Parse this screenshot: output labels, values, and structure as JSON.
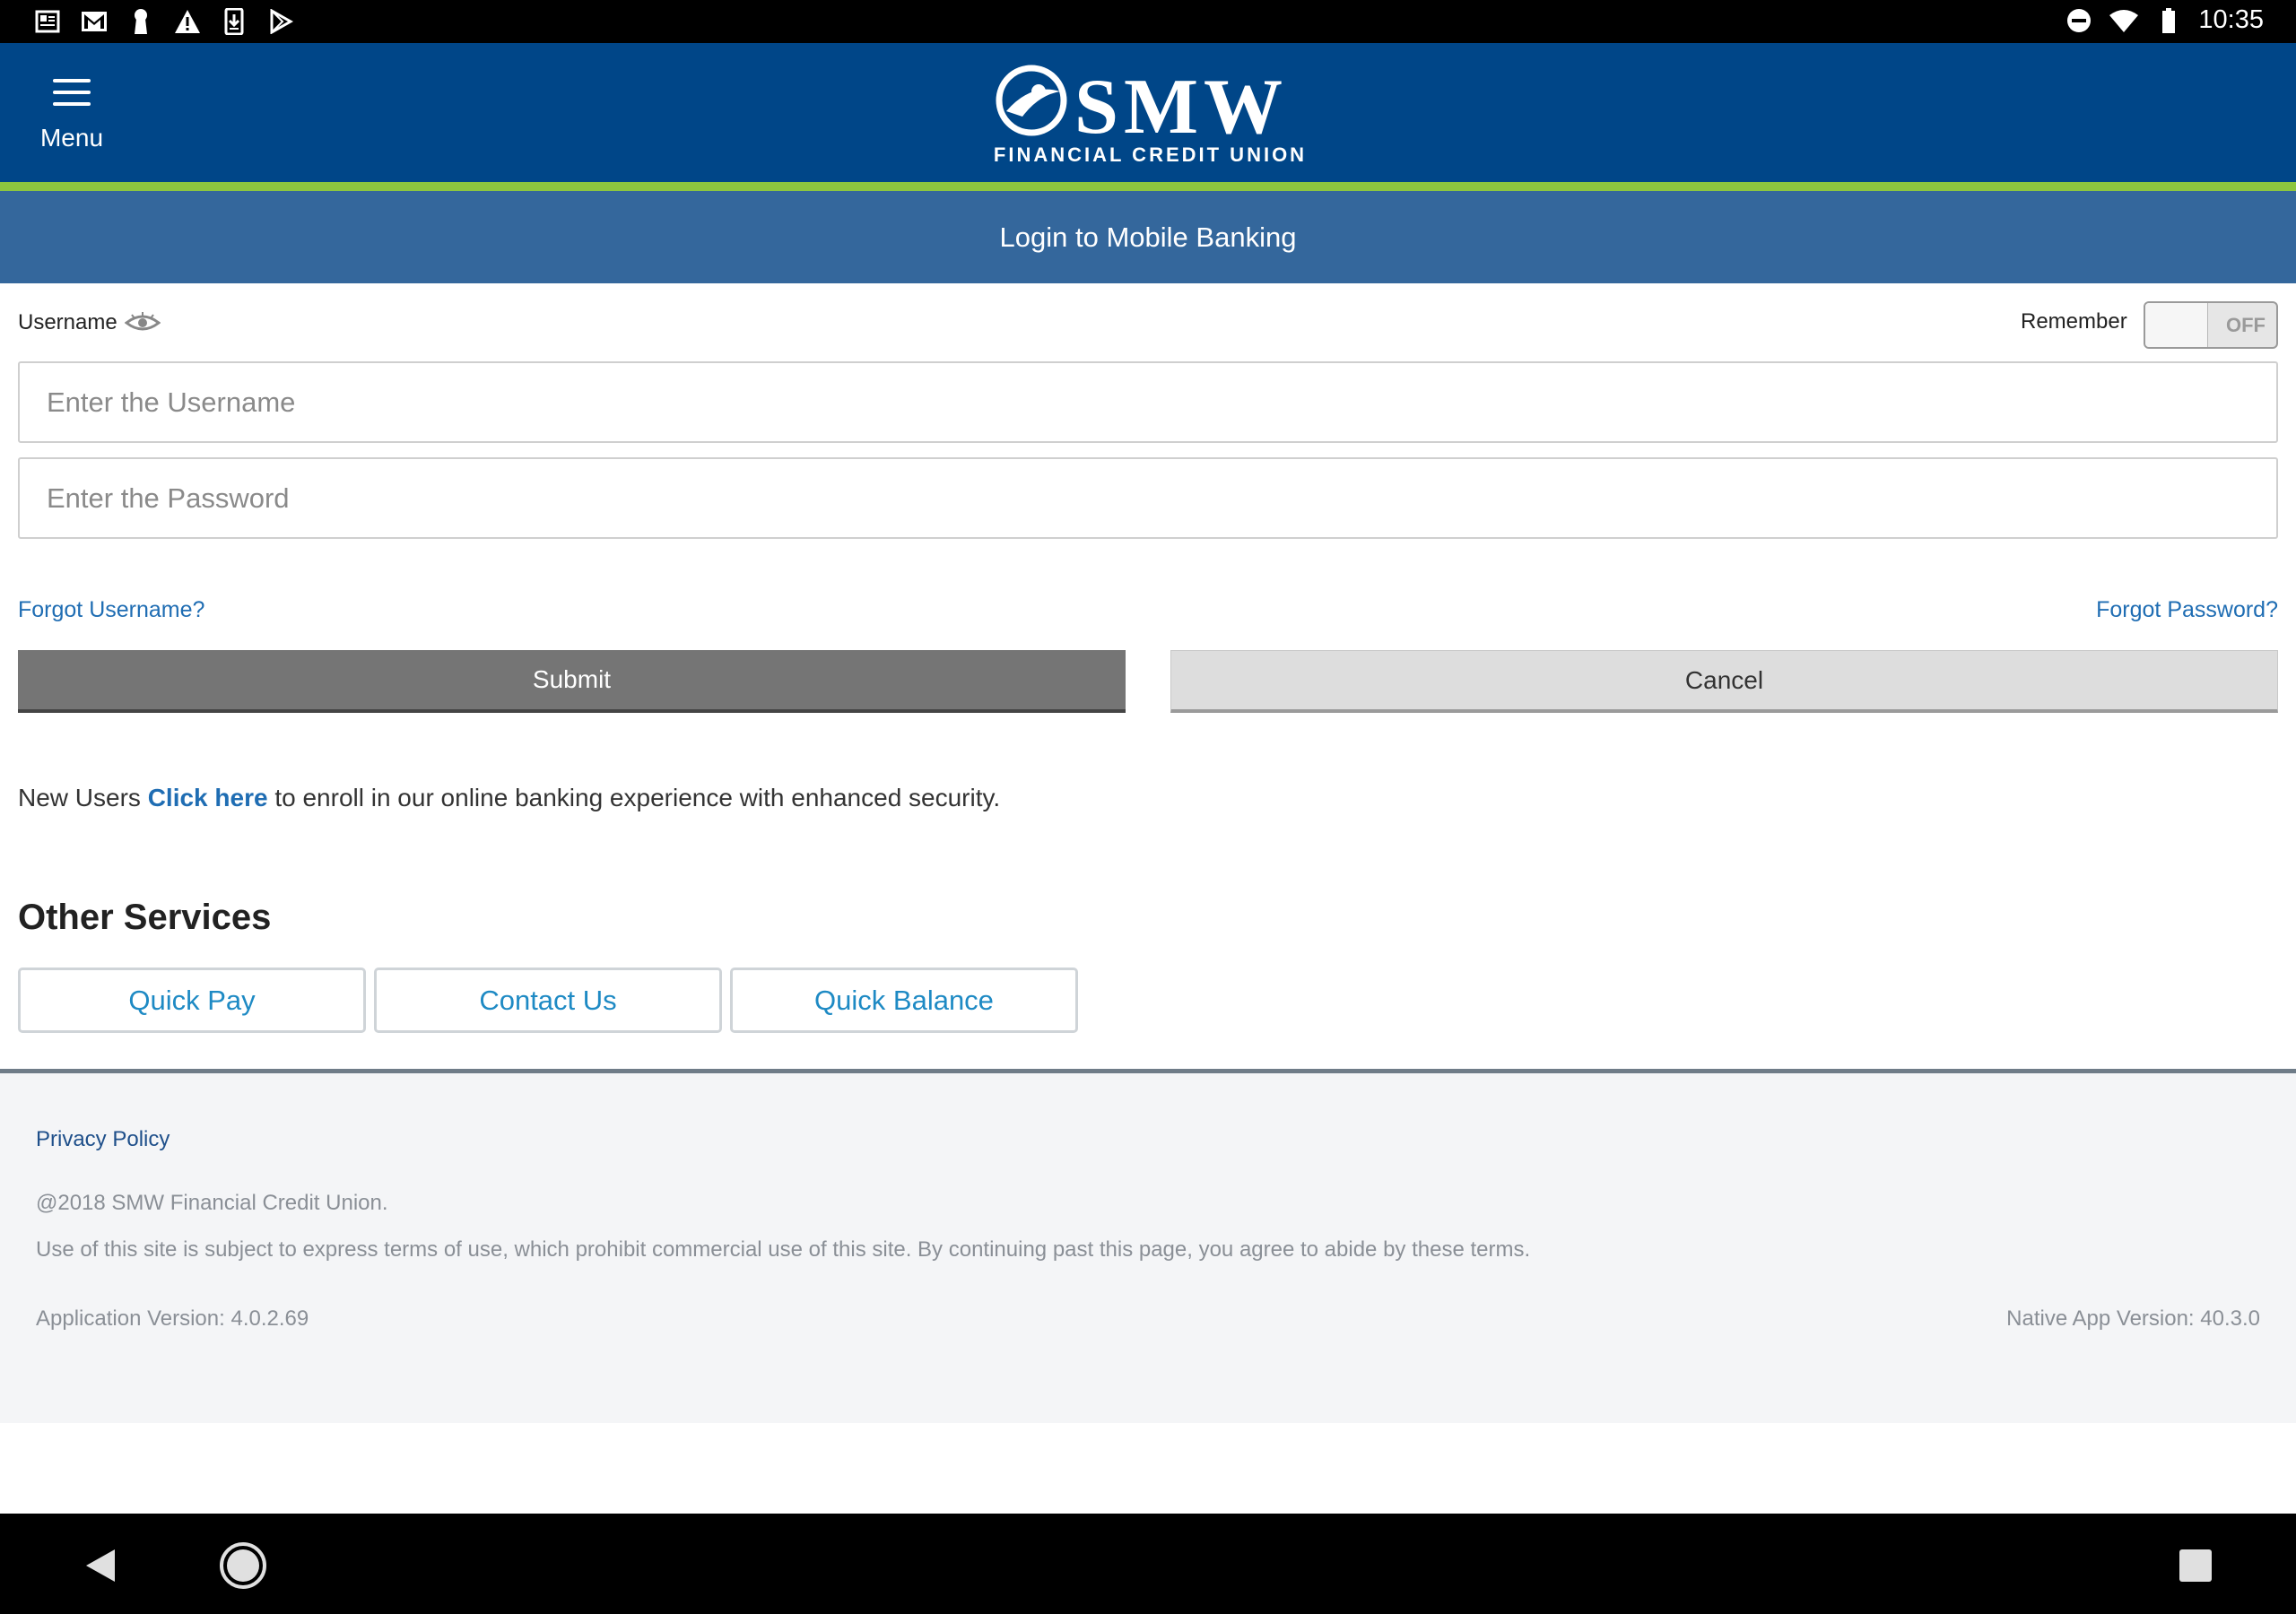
{
  "status_bar": {
    "time": "10:35",
    "left_icons": [
      "news-icon",
      "gmail-icon",
      "keyhole-icon",
      "warning-icon",
      "download-icon",
      "play-store-icon"
    ],
    "right_icons": [
      "do-not-disturb-icon",
      "wifi-icon",
      "battery-icon"
    ]
  },
  "header": {
    "menu_label": "Menu",
    "logo_text": "SMW",
    "logo_subtitle": "FINANCIAL CREDIT UNION",
    "brand_color": "#004688",
    "accent_color": "#8dc63f"
  },
  "title_bar": {
    "title": "Login to Mobile Banking"
  },
  "login": {
    "username_label": "Username",
    "remember_label": "Remember",
    "remember_state": "OFF",
    "username_placeholder": "Enter the Username",
    "password_placeholder": "Enter the Password",
    "forgot_username": "Forgot Username?",
    "forgot_password": "Forgot Password?",
    "submit_label": "Submit",
    "cancel_label": "Cancel"
  },
  "enroll": {
    "prefix": "New Users ",
    "link": "Click here",
    "suffix": " to enroll in our online banking experience with enhanced security."
  },
  "other_services": {
    "title": "Other Services",
    "buttons": [
      "Quick Pay",
      "Contact Us",
      "Quick Balance"
    ]
  },
  "footer": {
    "privacy": "Privacy Policy",
    "copyright": "@2018 SMW Financial Credit Union.",
    "terms": "Use of this site is subject to express terms of use, which prohibit commercial use of this site. By continuing past this page, you agree to abide by these terms.",
    "app_version": "Application Version: 4.0.2.69",
    "native_version": "Native App Version: 40.3.0"
  },
  "nav_bar": {
    "icons": [
      "back-icon",
      "home-icon",
      "recents-icon"
    ]
  }
}
